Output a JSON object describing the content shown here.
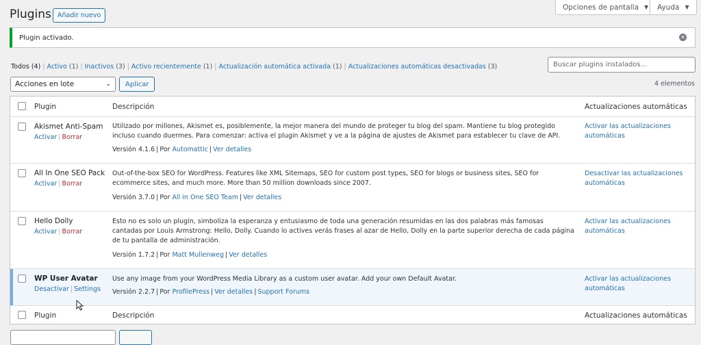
{
  "header": {
    "screen_options": "Opciones de pantalla",
    "help": "Ayuda",
    "title": "Plugins",
    "add_new": "Añadir nuevo"
  },
  "notice": {
    "text": "Plugin activado."
  },
  "filters": {
    "all": "Todos",
    "all_count": "(4)",
    "active": "Activo",
    "active_count": "(1)",
    "inactive": "Inactivos",
    "inactive_count": "(3)",
    "recent": "Activo recientemente",
    "recent_count": "(1)",
    "auto_on": "Actualización automática activada",
    "auto_on_count": "(1)",
    "auto_off": "Actualizaciones automáticas desactivadas",
    "auto_off_count": "(3)"
  },
  "search": {
    "placeholder": "Buscar plugins instalados..."
  },
  "bulk": {
    "selected": "Acciones en lote",
    "apply": "Aplicar",
    "count": "4 elementos"
  },
  "table": {
    "headers": {
      "plugin": "Plugin",
      "description": "Descripción",
      "auto_updates": "Actualizaciones automáticas"
    },
    "rows": [
      {
        "name": "Akismet Anti-Spam",
        "action1": "Activar",
        "action2": "Borrar",
        "description": "Utilizado por millones, Akismet es, posiblemente, la mejor manera del mundo de proteger tu blog del spam. Mantiene tu blog protegido incluso cuando duermes. Para comenzar: activa el plugin Akismet y ve a la página de ajustes de Akismet para establecer tu clave de API.",
        "version": "Versión 4.1.6",
        "by": "Por",
        "author": "Automattic",
        "details": "Ver detalles",
        "auto": "Activar las actualizaciones automáticas"
      },
      {
        "name": "All In One SEO Pack",
        "action1": "Activar",
        "action2": "Borrar",
        "description": "Out-of-the-box SEO for WordPress. Features like XML Sitemaps, SEO for custom post types, SEO for blogs or business sites, SEO for ecommerce sites, and much more. More than 50 million downloads since 2007.",
        "version": "Versión 3.7.0",
        "by": "Por",
        "author": "All in One SEO Team",
        "details": "Ver detalles",
        "auto": "Desactivar las actualizaciones automáticas"
      },
      {
        "name": "Hello Dolly",
        "action1": "Activar",
        "action2": "Borrar",
        "description": "Esto no es solo un plugin, simboliza la esperanza y entusiasmo de toda una generación resumidas en las dos palabras más famosas cantadas por Louis Armstrong: Hello, Dolly. Cuando lo actives verás frases al azar de Hello, Dolly en la parte superior derecha de cada página de tu pantalla de administración.",
        "version": "Versión 1.7.2",
        "by": "Por",
        "author": "Matt Mullenweg",
        "details": "Ver detalles",
        "auto": "Activar las actualizaciones automáticas"
      },
      {
        "name": "WP User Avatar",
        "action1": "Desactivar",
        "action2": "Settings",
        "description": "Use any image from your WordPress Media Library as a custom user avatar. Add your own Default Avatar.",
        "version": "Versión 2.2.7",
        "by": "Por",
        "author": "ProfilePress",
        "details": "Ver detalles",
        "extra": "Support Forums",
        "auto": "Activar las actualizaciones automáticas"
      }
    ]
  },
  "colors": {
    "link": "#2271b1",
    "delete": "#b32d2e",
    "success": "#00a32a",
    "active_row": "#f0f6fc",
    "active_bar": "#72aee6"
  }
}
